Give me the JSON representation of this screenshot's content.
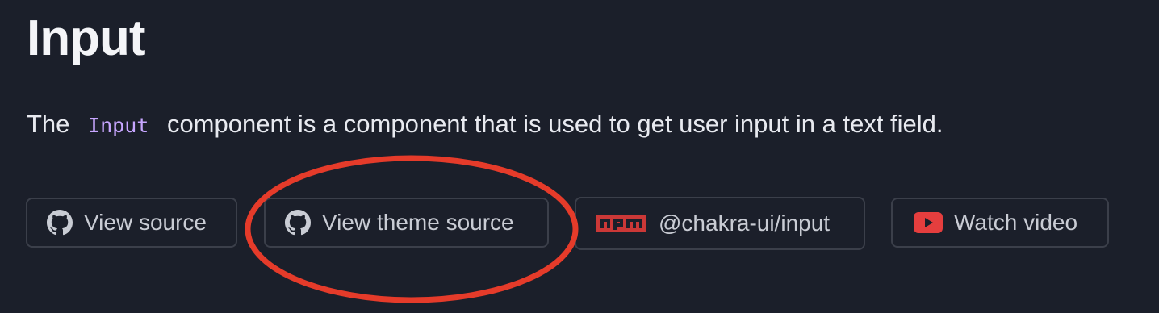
{
  "page": {
    "title": "Input",
    "description_before": "The",
    "description_code": "Input",
    "description_after": "component is a component that is used to get user input in a text field."
  },
  "links": {
    "view_source": "View source",
    "view_theme_source": "View theme source",
    "npm_package": "@chakra-ui/input",
    "watch_video": "Watch video"
  },
  "icons": {
    "view_source": "github-icon",
    "view_theme_source": "github-icon",
    "npm_package": "npm-icon",
    "watch_video": "youtube-icon"
  },
  "colors": {
    "background": "#1b1f2a",
    "code_text": "#c7a6ff",
    "annotation": "#e53b2a",
    "npm": "#cb3837",
    "youtube": "#e53e3e"
  }
}
